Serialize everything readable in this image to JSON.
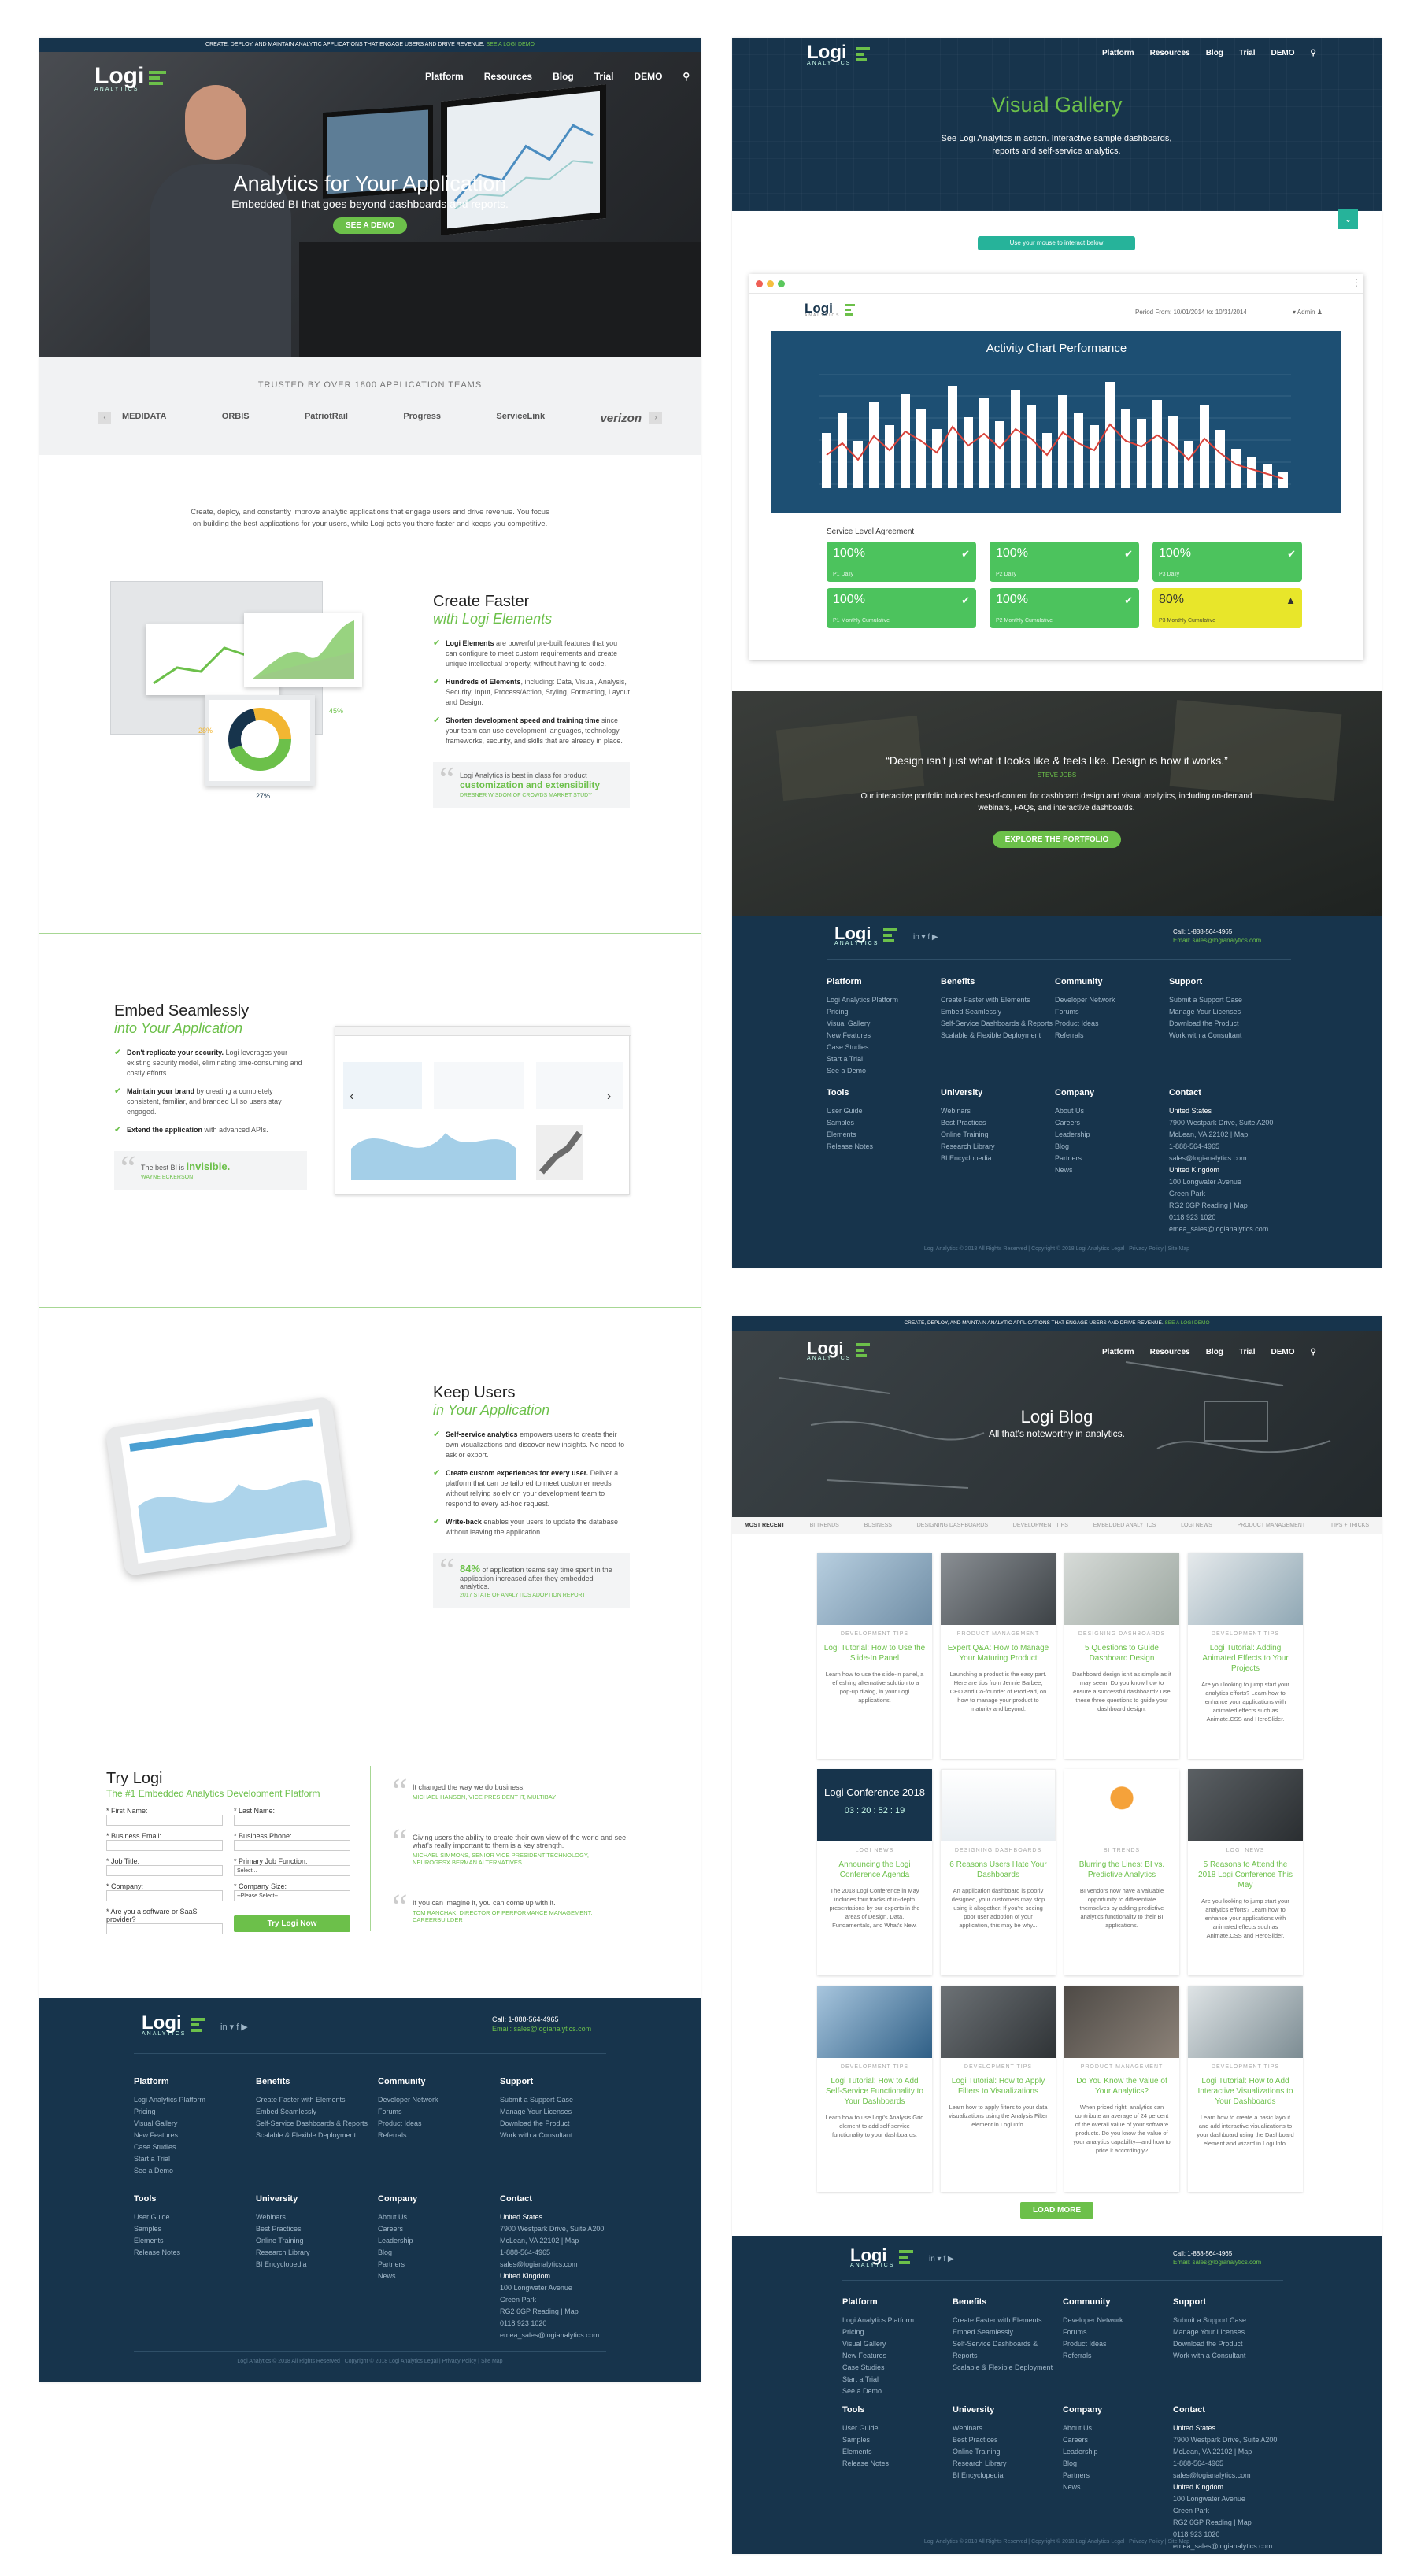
{
  "left": {
    "topbar": {
      "text": "CREATE, DEPLOY, AND MAINTAIN ANALYTIC APPLICATIONS THAT ENGAGE USERS AND DRIVE REVENUE.",
      "link": "SEE A LOGI DEMO"
    },
    "logo": {
      "word": "Logi",
      "sub": "ANALYTICS"
    },
    "nav": [
      "Platform",
      "Resources",
      "Blog",
      "Trial",
      "DEMO"
    ],
    "hero": {
      "title": "Analytics for Your Application",
      "subtitle": "Embedded BI that goes beyond dashboards and reports.",
      "cta": "SEE A DEMO"
    },
    "trusted": {
      "title": "TRUSTED BY OVER 1800 APPLICATION TEAMS",
      "logos": [
        "MEDIDATA",
        "ORBIS",
        "PatriotRail",
        "Progress",
        "ServiceLink",
        "verizon"
      ]
    },
    "intro": "Create, deploy, and constantly improve analytic applications that engage users and drive revenue. You focus on building the best applications for your users, while Logi gets you there faster and keeps you competitive.",
    "create": {
      "title": "Create Faster",
      "subtitle": "with Logi Elements",
      "bullets": [
        {
          "b": "Logi Elements",
          "t": " are powerful pre-built features that you can configure to meet custom requirements and create unique intellectual property, without having to code."
        },
        {
          "b": "Hundreds of Elements",
          "t": ", including: Data, Visual, Analysis, Security, Input, Process/Action, Styling, Formatting, Layout and Design."
        },
        {
          "b": "Shorten development speed and training time",
          "t": " since your team can use development languages, technology frameworks, security, and skills that are already in place."
        }
      ],
      "quote": {
        "pre": "Logi Analytics is best in class for product",
        "hl": "customization and extensibility",
        "src": "DRESNER WISDOM OF CROWDS MARKET STUDY"
      },
      "pie": {
        "a": "45%",
        "b": "27%",
        "c": "28%"
      }
    },
    "embed": {
      "title": "Embed Seamlessly",
      "subtitle": "into Your Application",
      "bullets": [
        {
          "b": "Don't replicate your security.",
          "t": " Logi leverages your existing security model, eliminating time-consuming and costly efforts."
        },
        {
          "b": "Maintain your brand",
          "t": " by creating a completely consistent, familiar, and branded UI so users stay engaged."
        },
        {
          "b": "Extend the application",
          "t": " with advanced APIs."
        }
      ],
      "quote": {
        "pre": "The best BI is",
        "hl": "invisible.",
        "src": "WAYNE ECKERSON"
      }
    },
    "keep": {
      "title": "Keep Users",
      "subtitle": "in Your Application",
      "bullets": [
        {
          "b": "Self-service analytics",
          "t": " empowers users to create their own visualizations and discover new insights. No need to ask or export."
        },
        {
          "b": "Create custom experiences for every user.",
          "t": " Deliver a platform that can be tailored to meet customer needs without relying solely on your development team to respond to every ad-hoc request."
        },
        {
          "b": "Write-back",
          "t": " enables your users to update the database without leaving the application."
        }
      ],
      "quote": {
        "hl": "84%",
        "t": " of application teams say time spent in the application increased after they embedded analytics.",
        "src": "2017 STATE OF ANALYTICS ADOPTION REPORT"
      }
    },
    "trylogi": {
      "title": "Try Logi",
      "subtitle": "The #1 Embedded Analytics Development Platform",
      "fields": [
        "* First Name:",
        "* Last Name:",
        "* Business Email:",
        "* Business Phone:",
        "* Job Title:",
        "* Primary Job Function:",
        "* Company:",
        "* Company Size:",
        "* Are you a software or SaaS provider?"
      ],
      "select": "Select...",
      "select2": "--Please Select--",
      "button": "Try Logi Now",
      "testimonials": [
        {
          "q": "It changed the way we do business.",
          "a": "MICHAEL HANSON, VICE PRESIDENT IT, MULTIBAY"
        },
        {
          "q": "Giving users the ability to create their own view of the world and see what's really important to them is a key strength.",
          "a": "MICHAEL SIMMONS, SENIOR VICE PRESIDENT TECHNOLOGY, NEUROGESX BERMAN ALTERNATIVES"
        },
        {
          "q": "If you can imagine it, you can come up with it.",
          "a": "TOM RANCHAK, DIRECTOR OF PERFORMANCE MANAGEMENT, CAREERBUILDER"
        }
      ]
    }
  },
  "footer": {
    "phone": "Call: 1-888-564-4965",
    "email": "Email: sales@logianalytics.com",
    "social": "in  ▾  f  ▶",
    "cols": [
      {
        "h": "Platform",
        "items": [
          "Logi Analytics Platform",
          "Pricing",
          "Visual Gallery",
          "New Features",
          "Case Studies",
          "Start a Trial",
          "See a Demo"
        ]
      },
      {
        "h": "Benefits",
        "items": [
          "Create Faster with Elements",
          "Embed Seamlessly",
          "Self-Service Dashboards & Reports",
          "Scalable & Flexible Deployment"
        ]
      },
      {
        "h": "Community",
        "items": [
          "Developer Network",
          "Forums",
          "Product Ideas",
          "Referrals"
        ]
      },
      {
        "h": "Support",
        "items": [
          "Submit a Support Case",
          "Manage Your Licenses",
          "Download the Product",
          "Work with a Consultant"
        ]
      },
      {
        "h": "Tools",
        "items": [
          "User Guide",
          "Samples",
          "Elements",
          "Release Notes"
        ]
      },
      {
        "h": "University",
        "items": [
          "Webinars",
          "Best Practices",
          "Online Training",
          "Research Library",
          "BI Encyclopedia"
        ]
      },
      {
        "h": "Company",
        "items": [
          "About Us",
          "Careers",
          "Leadership",
          "Blog",
          "Partners",
          "News"
        ]
      },
      {
        "h": "Contact",
        "items": [
          "United States",
          "7900 Westpark Drive, Suite A200",
          "McLean, VA 22102 | Map",
          "1-888-564-4965",
          "sales@logianalytics.com",
          "United Kingdom",
          "100 Longwater Avenue",
          "Green Park",
          "RG2 6GP Reading | Map",
          "0118 923 1020",
          "emea_sales@logianalytics.com"
        ]
      }
    ],
    "copyright": "Logi Analytics © 2018 All Rights Reserved | Copyright © 2018 Logi Analytics Legal | Privacy Policy | Site Map"
  },
  "gallery": {
    "title": "Visual Gallery",
    "desc": "See Logi Analytics in action. Interactive sample dashboards, reports and self-service analytics.",
    "hint": "Use your mouse to interact below",
    "period": "Period From: 10/01/2014 to: 10/31/2014",
    "admin": "Admin",
    "chart_title": "Activity Chart Performance",
    "sla_title": "Service Level Agreement",
    "tiles": [
      {
        "v": "100%",
        "l": "P1 Daily",
        "c": "#4cc35d"
      },
      {
        "v": "100%",
        "l": "P2 Daily",
        "c": "#4cc35d"
      },
      {
        "v": "100%",
        "l": "P3 Daily",
        "c": "#4cc35d"
      },
      {
        "v": "100%",
        "l": "P1 Monthly Cumulative",
        "c": "#4cc35d"
      },
      {
        "v": "100%",
        "l": "P2 Monthly Cumulative",
        "c": "#4cc35d"
      },
      {
        "v": "80%",
        "l": "P3 Monthly Cumulative",
        "c": "#e8e62a"
      }
    ]
  },
  "portfolio": {
    "quote": "“Design isn't just what it looks like & feels like. Design is how it works.”",
    "author": "STEVE JOBS",
    "desc": "Our interactive portfolio includes best-of-content for dashboard design and visual analytics, including on-demand webinars, FAQs, and interactive dashboards.",
    "cta": "EXPLORE THE PORTFOLIO"
  },
  "blog": {
    "title": "Logi Blog",
    "subtitle": "All that's noteworthy in analytics.",
    "tabs": [
      "MOST RECENT",
      "BI TRENDS",
      "BUSINESS",
      "DESIGNING DASHBOARDS",
      "DEVELOPMENT TIPS",
      "EMBEDDED ANALYTICS",
      "LOGI NEWS",
      "PRODUCT MANAGEMENT",
      "TIPS + TRICKS"
    ],
    "posts": [
      {
        "cat": "DEVELOPMENT TIPS",
        "t": "Logi Tutorial: How to Use the Slide-In Panel",
        "e": "Learn how to use the slide-in panel, a refreshing alternative solution to a pop-up dialog, in your Logi applications."
      },
      {
        "cat": "PRODUCT MANAGEMENT",
        "t": "Expert Q&A: How to Manage Your Maturing Product",
        "e": "Launching a product is the easy part. Here are tips from Jennie Barbee, CEO and Co-founder of ProdPad, on how to manage your product to maturity and beyond."
      },
      {
        "cat": "DESIGNING DASHBOARDS",
        "t": "5 Questions to Guide Dashboard Design",
        "e": "Dashboard design isn't as simple as it may seem. Do you know how to ensure a successful dashboard? Use these three questions to guide your dashboard design."
      },
      {
        "cat": "DEVELOPMENT TIPS",
        "t": "Logi Tutorial: Adding Animated Effects to Your Projects",
        "e": "Are you looking to jump start your analytics efforts? Learn how to enhance your applications with animated effects such as Animate.CSS and HeroSlider."
      },
      {
        "cat": "LOGI NEWS",
        "t": "Announcing the Logi Conference Agenda",
        "e": "The 2018 Logi Conference in May includes four tracks of in-depth presentations by our experts in the areas of Design, Data, Fundamentals, and What's New."
      },
      {
        "cat": "DESIGNING DASHBOARDS",
        "t": "6 Reasons Users Hate Your Dashboards",
        "e": "An application dashboard is poorly designed, your customers may stop using it altogether. If you're seeing poor user adoption of your application, this may be why..."
      },
      {
        "cat": "BI TRENDS",
        "t": "Blurring the Lines: BI vs. Predictive Analytics",
        "e": "BI vendors now have a valuable opportunity to differentiate themselves by adding predictive analytics functionality to their BI applications."
      },
      {
        "cat": "LOGI NEWS",
        "t": "5 Reasons to Attend the 2018 Logi Conference This May",
        "e": "Are you looking to jump start your analytics efforts? Learn how to enhance your applications with animated effects such as Animate.CSS and HeroSlider."
      },
      {
        "cat": "DEVELOPMENT TIPS",
        "t": "Logi Tutorial: How to Add Self-Service Functionality to Your Dashboards",
        "e": "Learn how to use Logi's Analysis Grid element to add self-service functionality to your dashboards."
      },
      {
        "cat": "DEVELOPMENT TIPS",
        "t": "Logi Tutorial: How to Apply Filters to Visualizations",
        "e": "Learn how to apply filters to your data visualizations using the Analysis Filter element in Logi Info."
      },
      {
        "cat": "PRODUCT MANAGEMENT",
        "t": "Do You Know the Value of Your Analytics?",
        "e": "When priced right, analytics can contribute an average of 24 percent of the overall value of your software products. Do you know the value of your analytics capability—and how to price it accordingly?"
      },
      {
        "cat": "DEVELOPMENT TIPS",
        "t": "Logi Tutorial: How to Add Interactive Visualizations to Your Dashboards",
        "e": "Learn how to create a basic layout and add interactive visualizations to your dashboard using the Dashboard element and wizard in Logi Info."
      }
    ],
    "conference": {
      "title": "Logi Conference 2018",
      "count": "03 : 20 : 52 : 19"
    },
    "more": "LOAD MORE"
  },
  "colors": {
    "navy": "#17344c",
    "green": "#6cc04a",
    "chart": "#1d4f73"
  }
}
